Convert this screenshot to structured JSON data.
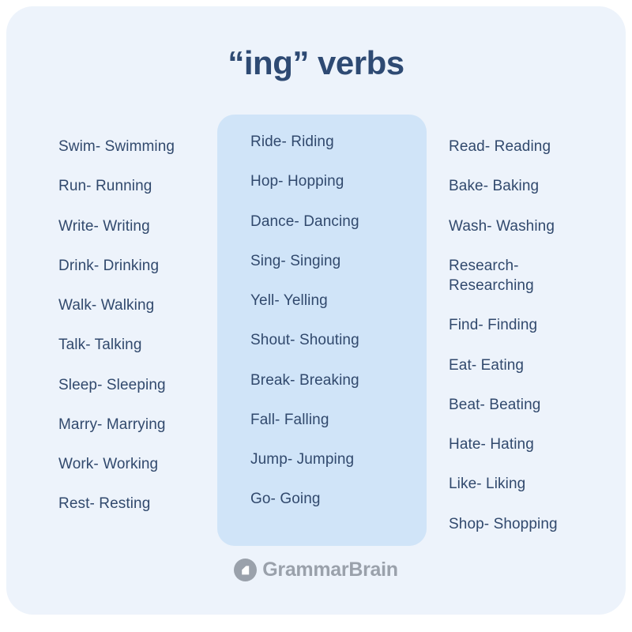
{
  "title": "“ing” verbs",
  "colors": {
    "page_background": "#ffffff",
    "card_background": "#edf3fb",
    "highlight_panel_background": "#d0e4f8",
    "title_text": "#2e4a73",
    "body_text": "#31496d",
    "footer_text": "#9aa1ab"
  },
  "columns": [
    {
      "name": "left-column",
      "highlighted": false,
      "items": [
        "Swim- Swimming",
        "Run- Running",
        "Write- Writing",
        "Drink- Drinking",
        "Walk- Walking",
        "Talk- Talking",
        "Sleep- Sleeping",
        "Marry- Marrying",
        "Work- Working",
        "Rest- Resting"
      ]
    },
    {
      "name": "middle-column",
      "highlighted": true,
      "items": [
        "Ride- Riding",
        "Hop- Hopping",
        "Dance- Dancing",
        "Sing- Singing",
        "Yell- Yelling",
        "Shout- Shouting",
        "Break- Breaking",
        "Fall- Falling",
        "Jump- Jumping",
        "Go- Going"
      ]
    },
    {
      "name": "right-column",
      "highlighted": false,
      "items": [
        "Read- Reading",
        "Bake- Baking",
        "Wash- Washing",
        "Research- Researching",
        "Find- Finding",
        "Eat- Eating",
        "Beat- Beating",
        "Hate- Hating",
        "Like- Liking",
        "Shop- Shopping"
      ]
    }
  ],
  "footer": {
    "logo_icon": "grammarbrain-home-icon",
    "brand_name": "GrammarBrain"
  }
}
